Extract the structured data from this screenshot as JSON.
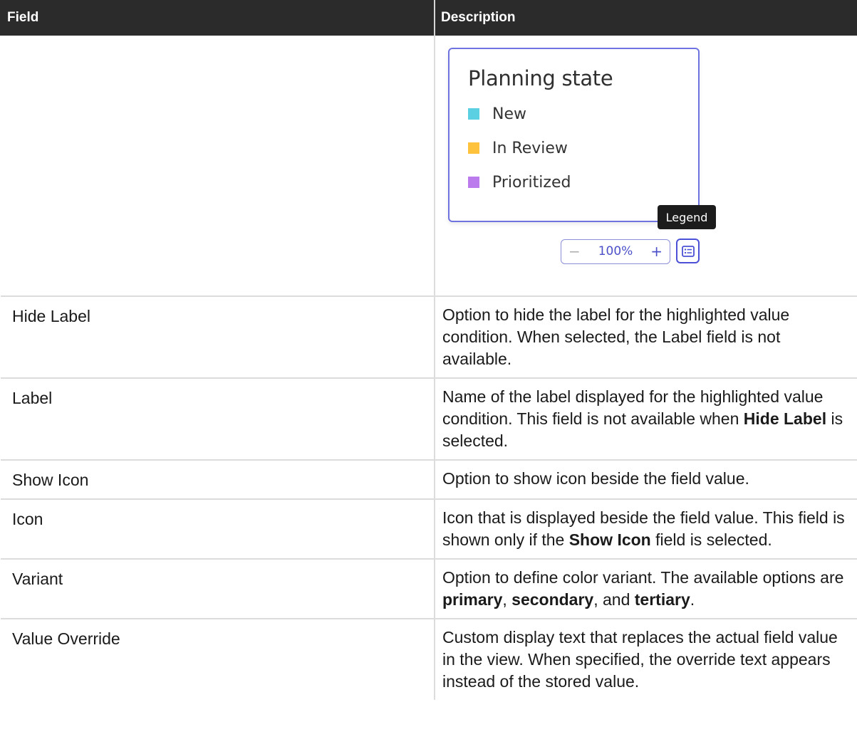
{
  "table": {
    "headers": {
      "field": "Field",
      "description": "Description"
    },
    "legend_preview": {
      "title": "Planning state",
      "items": [
        {
          "label": "New",
          "color": "#5bd0e3"
        },
        {
          "label": "In Review",
          "color": "#ffc23d"
        },
        {
          "label": "Prioritized",
          "color": "#bb7bec"
        }
      ],
      "tooltip": "Legend",
      "zoom": {
        "minus": "−",
        "level": "100%",
        "plus": "+"
      },
      "legend_button_icon": "legend-list-icon"
    },
    "rows": [
      {
        "field": "Hide Label",
        "description": "Option to hide the label for the highlighted value condition. When selected, the Label field is not available."
      },
      {
        "field": "Label",
        "description_before": "Name of the label displayed for the highlighted value condition. This field is not available when ",
        "description_bold": "Hide Label",
        "description_after": " is selected."
      },
      {
        "field": "Show Icon",
        "description": "Option to show icon beside the field value."
      },
      {
        "field": "Icon",
        "description_before": "Icon that is displayed beside the field value. This field is shown only if the ",
        "description_bold": "Show Icon",
        "description_after": " field is selected."
      },
      {
        "field": "Variant",
        "description_before": "Option to define color variant. The available options are ",
        "bold_1": "primary",
        "sep_1": ", ",
        "bold_2": "secondary",
        "sep_2": ", and ",
        "bold_3": "tertiary",
        "end": "."
      },
      {
        "field": "Value Override",
        "description": "Custom display text that replaces the actual field value in the view. When specified, the override text appears instead of the stored value."
      }
    ]
  }
}
